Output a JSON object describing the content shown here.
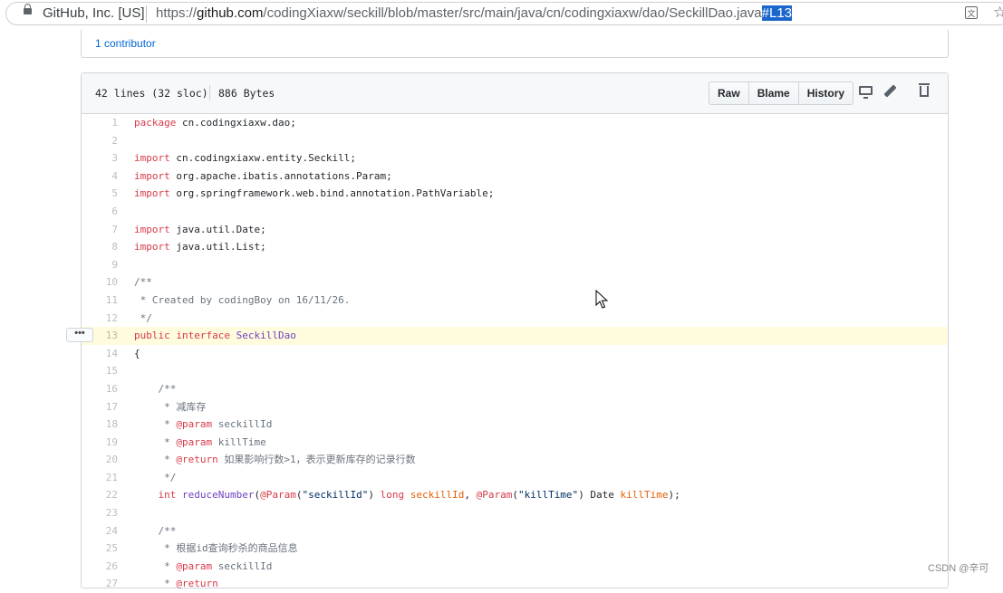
{
  "browser": {
    "site_identity": "GitHub, Inc. [US]",
    "url_prefix": "https://",
    "url_host": "github.com",
    "url_path": "/codingXiaxw/seckill/blob/master/src/main/java/cn/codingxiaxw/dao/SeckillDao.java",
    "url_hash": "#L13"
  },
  "contributors": {
    "label": "1 contributor"
  },
  "file": {
    "lines_info": "42 lines (32 sloc)",
    "size": "886 Bytes",
    "buttons": {
      "raw": "Raw",
      "blame": "Blame",
      "history": "History"
    },
    "icons": [
      "desktop-icon",
      "pencil-icon",
      "trash-icon"
    ]
  },
  "code_lines": [
    {
      "n": "1",
      "segs": [
        [
          "k",
          "package"
        ],
        [
          "t",
          " cn.codingxiaxw.dao;"
        ]
      ]
    },
    {
      "n": "2",
      "segs": []
    },
    {
      "n": "3",
      "segs": [
        [
          "k",
          "import"
        ],
        [
          "t",
          " cn.codingxiaxw.entity.Seckill;"
        ]
      ]
    },
    {
      "n": "4",
      "segs": [
        [
          "k",
          "import"
        ],
        [
          "t",
          " org.apache.ibatis.annotations.Param;"
        ]
      ]
    },
    {
      "n": "5",
      "segs": [
        [
          "k",
          "import"
        ],
        [
          "t",
          " org.springframework.web.bind.annotation.PathVariable;"
        ]
      ]
    },
    {
      "n": "6",
      "segs": []
    },
    {
      "n": "7",
      "segs": [
        [
          "k",
          "import"
        ],
        [
          "t",
          " java.util.Date;"
        ]
      ]
    },
    {
      "n": "8",
      "segs": [
        [
          "k",
          "import"
        ],
        [
          "t",
          " java.util.List;"
        ]
      ]
    },
    {
      "n": "9",
      "segs": []
    },
    {
      "n": "10",
      "segs": [
        [
          "c",
          "/**"
        ]
      ]
    },
    {
      "n": "11",
      "segs": [
        [
          "c",
          " * Created by codingBoy on 16/11/26."
        ]
      ]
    },
    {
      "n": "12",
      "segs": [
        [
          "c",
          " */"
        ]
      ]
    },
    {
      "n": "13",
      "segs": [
        [
          "k",
          "public"
        ],
        [
          "t",
          " "
        ],
        [
          "k",
          "interface"
        ],
        [
          "t",
          " "
        ],
        [
          "e",
          "SeckillDao"
        ]
      ]
    },
    {
      "n": "14",
      "segs": [
        [
          "t",
          "{"
        ]
      ]
    },
    {
      "n": "15",
      "segs": []
    },
    {
      "n": "16",
      "segs": [
        [
          "c",
          "    /**"
        ]
      ]
    },
    {
      "n": "17",
      "segs": [
        [
          "c",
          "     * 减库存"
        ]
      ]
    },
    {
      "n": "18",
      "segs": [
        [
          "c",
          "     * "
        ],
        [
          "k",
          "@param"
        ],
        [
          "c",
          " seckillId"
        ]
      ]
    },
    {
      "n": "19",
      "segs": [
        [
          "c",
          "     * "
        ],
        [
          "k",
          "@param"
        ],
        [
          "c",
          " killTime"
        ]
      ]
    },
    {
      "n": "20",
      "segs": [
        [
          "c",
          "     * "
        ],
        [
          "k",
          "@return"
        ],
        [
          "c",
          " 如果影响行数>1，表示更新库存的记录行数"
        ]
      ]
    },
    {
      "n": "21",
      "segs": [
        [
          "c",
          "     */"
        ]
      ]
    },
    {
      "n": "22",
      "segs": [
        [
          "t",
          "    "
        ],
        [
          "k",
          "int"
        ],
        [
          "t",
          " "
        ],
        [
          "e",
          "reduceNumber"
        ],
        [
          "t",
          "("
        ],
        [
          "k",
          "@Param"
        ],
        [
          "t",
          "("
        ],
        [
          "s",
          "\"seckillId\""
        ],
        [
          "t",
          ") "
        ],
        [
          "k",
          "long"
        ],
        [
          "t",
          " "
        ],
        [
          "v",
          "seckillId"
        ],
        [
          "t",
          ", "
        ],
        [
          "k",
          "@Param"
        ],
        [
          "t",
          "("
        ],
        [
          "s",
          "\"killTime\""
        ],
        [
          "t",
          ") Date "
        ],
        [
          "v",
          "killTime"
        ],
        [
          "t",
          ");"
        ]
      ]
    },
    {
      "n": "23",
      "segs": []
    },
    {
      "n": "24",
      "segs": [
        [
          "c",
          "    /**"
        ]
      ]
    },
    {
      "n": "25",
      "segs": [
        [
          "c",
          "     * 根据id查询秒杀的商品信息"
        ]
      ]
    },
    {
      "n": "26",
      "segs": [
        [
          "c",
          "     * "
        ],
        [
          "k",
          "@param"
        ],
        [
          "c",
          " seckillId"
        ]
      ]
    },
    {
      "n": "27",
      "segs": [
        [
          "c",
          "     * "
        ],
        [
          "k",
          "@return"
        ]
      ]
    }
  ],
  "highlighted_line": "13",
  "line_menu_label": "•••",
  "watermark": "CSDN @辛可"
}
